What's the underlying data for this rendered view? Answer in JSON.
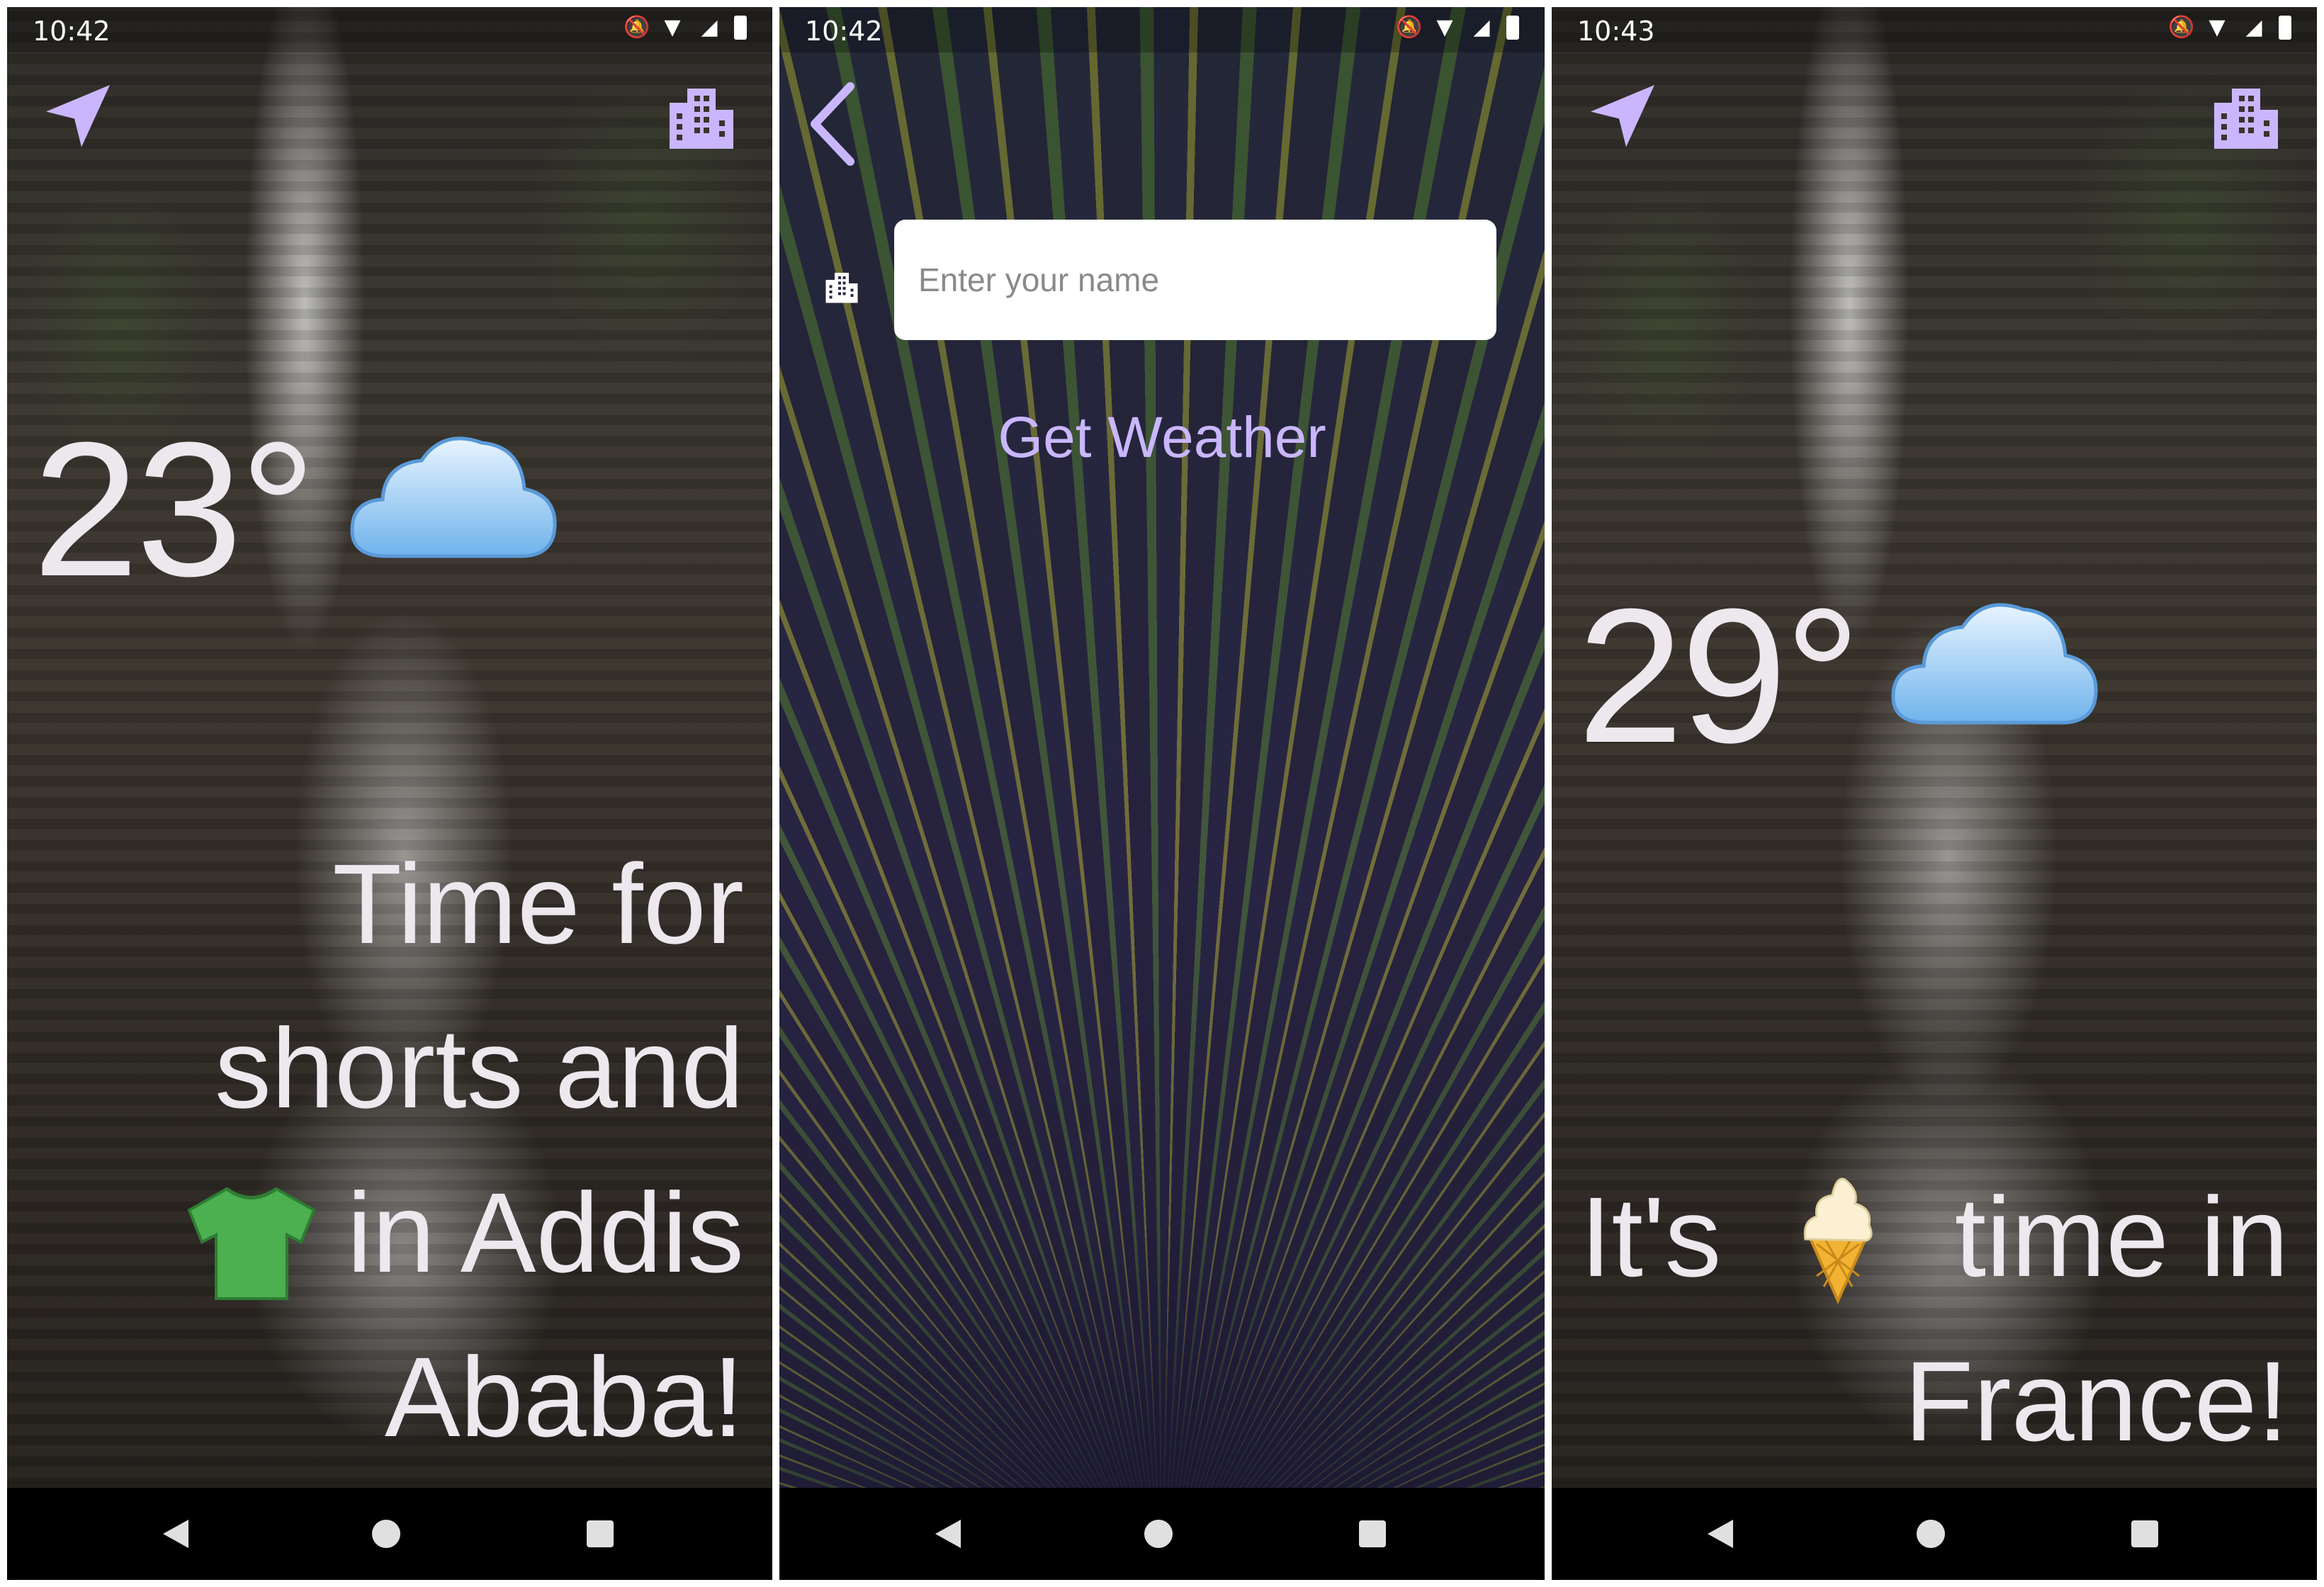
{
  "accent_color": "#c9b6ff",
  "screens": [
    {
      "status_time": "10:42",
      "temperature": "23°",
      "weather_icon": "cloud-emoji",
      "message_lines": [
        "Time for",
        "shorts and",
        "in Addis",
        "Ababa!"
      ],
      "message_emoji": "t-shirt-emoji"
    },
    {
      "status_time": "10:42",
      "input_placeholder": "Enter your name",
      "button_label": "Get Weather"
    },
    {
      "status_time": "10:43",
      "temperature": "29°",
      "weather_icon": "cloud-emoji",
      "message_lines": [
        "It's",
        "time in",
        "France!"
      ],
      "message_emoji": "ice-cream-emoji"
    }
  ],
  "icons": [
    "location-arrow-icon",
    "city-icon",
    "back-chevron-icon",
    "mute-icon",
    "wifi-icon",
    "signal-icon",
    "battery-icon"
  ]
}
